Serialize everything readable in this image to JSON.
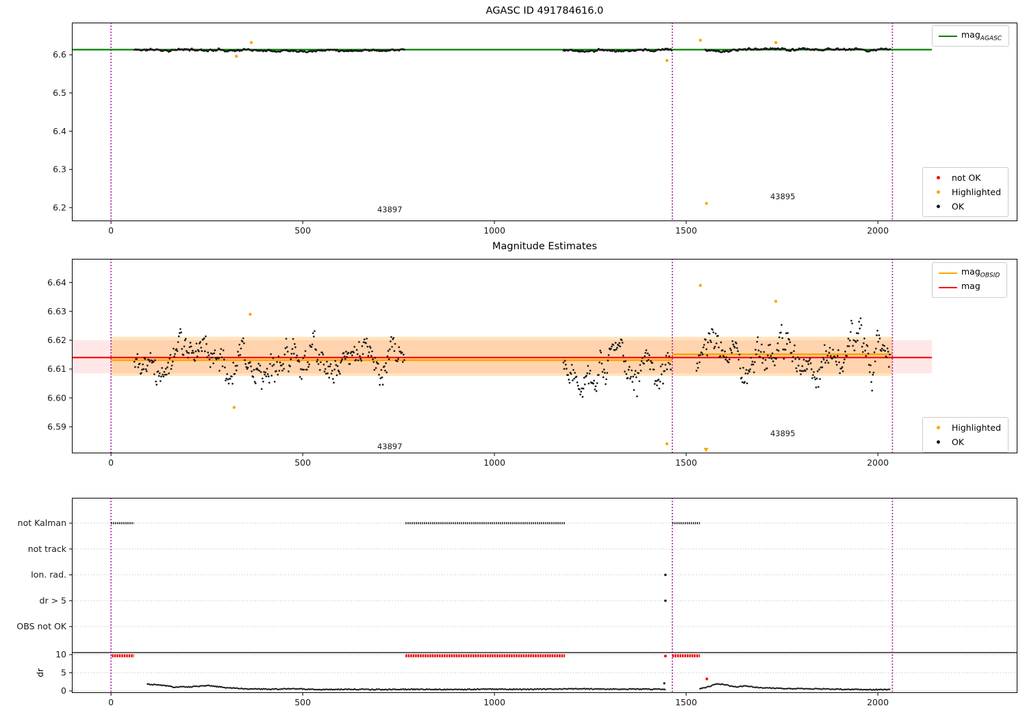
{
  "colors": {
    "agasc_line": "#008000",
    "obsid_line": "#ffa500",
    "mag_line": "#ff0000",
    "boundary_line": "#990099",
    "ok_marker": "#1a1a1a",
    "highlight_marker": "#ffa500",
    "notok_marker": "#ff0000",
    "cap_red": "#e81010",
    "grid": "#bbbbbb",
    "band_pink": "rgba(255,20,20,0.10)",
    "band_orange": "rgba(255,150,0,0.25)"
  },
  "chart_data": [
    {
      "id": "top",
      "type": "scatter",
      "title": "AGASC ID 491784616.0",
      "xlim": [
        -102,
        2364
      ],
      "ylim": [
        6.1645,
        6.6842
      ],
      "xticks": [
        0,
        500,
        1000,
        1500,
        2000
      ],
      "yticks": [
        6.2,
        6.3,
        6.4,
        6.5,
        6.6
      ],
      "ytick_labels": [
        "6.2",
        "6.3",
        "6.4",
        "6.5",
        "6.6"
      ],
      "grid": false,
      "legend_line": {
        "label_main": "mag",
        "label_sub": "AGASC"
      },
      "legend_markers": [
        {
          "label": "not OK",
          "color_key": "notok_marker"
        },
        {
          "label": "Highlighted",
          "color_key": "highlight_marker"
        },
        {
          "label": "OK",
          "color_key": "ok_marker"
        }
      ],
      "agasc_mag": {
        "value": 6.6134,
        "x0": -102,
        "x1": 2141
      },
      "obsid_boundaries": [
        0,
        1464,
        2038
      ],
      "scatter_segments": [
        {
          "x0": 61,
          "x1": 765,
          "mean": 6.6128,
          "amp": 0.0035,
          "seed": 11
        },
        {
          "x0": 1180,
          "x1": 1462,
          "mean": 6.6126,
          "amp": 0.0035,
          "seed": 12
        },
        {
          "x0": 1550,
          "x1": 2032,
          "mean": 6.6138,
          "amp": 0.0035,
          "seed": 13
        }
      ],
      "highlighted_points": [
        [
          327,
          6.596
        ],
        [
          366,
          6.632
        ],
        [
          1450,
          6.585
        ],
        [
          1537,
          6.638
        ],
        [
          1553,
          6.211
        ],
        [
          1734,
          6.632
        ]
      ],
      "annotations": [
        {
          "text": "43897",
          "x": 727,
          "y": 6.195
        },
        {
          "text": "43895",
          "x": 1752,
          "y": 6.229
        }
      ]
    },
    {
      "id": "middle",
      "type": "scatter",
      "title": "Magnitude Estimates",
      "xlim": [
        -102,
        2364
      ],
      "ylim": [
        6.5808,
        6.6482
      ],
      "xticks": [
        0,
        500,
        1000,
        1500,
        2000
      ],
      "yticks": [
        6.59,
        6.6,
        6.61,
        6.62,
        6.63,
        6.64
      ],
      "ytick_labels": [
        "6.59",
        "6.60",
        "6.61",
        "6.62",
        "6.63",
        "6.64"
      ],
      "grid": false,
      "legend_lines": [
        {
          "label_main": "mag",
          "label_sub": "OBSID",
          "color_key": "obsid_line"
        },
        {
          "label_main": "mag",
          "label_sub": "",
          "color_key": "mag_line"
        }
      ],
      "legend_markers": [
        {
          "label": "Highlighted",
          "color_key": "highlight_marker"
        },
        {
          "label": "OK",
          "color_key": "ok_marker"
        }
      ],
      "mag_line": {
        "value": 6.614,
        "x0": -102,
        "x1": 2141
      },
      "obsid_lines": [
        {
          "x0": 0,
          "x1": 1464,
          "value": 6.6131
        },
        {
          "x0": 1464,
          "x1": 2038,
          "value": 6.6151
        }
      ],
      "band_pink": {
        "x0": -102,
        "x1": 2141,
        "y0": 6.6085,
        "y1": 6.62
      },
      "band_orange": {
        "x0": 0,
        "x1": 2038,
        "y0": 6.6076,
        "y1": 6.6212
      },
      "obsid_boundaries": [
        0,
        1464,
        2038
      ],
      "scatter_segments": [
        {
          "x0": 61,
          "x1": 765,
          "mean": 6.6133,
          "amp": 0.0075,
          "seed": 21
        },
        {
          "x0": 1180,
          "x1": 1461,
          "mean": 6.6128,
          "amp": 0.0075,
          "seed": 22
        },
        {
          "x0": 1527,
          "x1": 2032,
          "mean": 6.6146,
          "amp": 0.0075,
          "seed": 23
        }
      ],
      "highlighted_points": [
        [
          321,
          6.5967
        ],
        [
          363,
          6.629
        ],
        [
          1450,
          6.5841
        ],
        [
          1537,
          6.639
        ],
        [
          1734,
          6.6335
        ]
      ],
      "clipped_low_points": [
        [
          1552,
          6.582
        ]
      ],
      "annotations": [
        {
          "text": "43897",
          "x": 727,
          "y": 6.5832
        },
        {
          "text": "43895",
          "x": 1752,
          "y": 6.5877
        }
      ]
    },
    {
      "id": "bottom",
      "type": "flags-and-dr",
      "categories": [
        "not Kalman",
        "not track",
        "Ion. rad.",
        "dr > 5",
        "OBS not OK"
      ],
      "ylabel": "dr",
      "dr_ticks": [
        0,
        5,
        10
      ],
      "dr_tick_labels": [
        "0",
        "5",
        "10"
      ],
      "xlim": [
        -102,
        2364
      ],
      "xticks": [
        0,
        500,
        1000,
        1500,
        2000
      ],
      "obsid_boundaries": [
        0,
        1464,
        2038
      ],
      "flag_segments": {
        "not Kalman": [
          [
            0,
            60
          ],
          [
            768,
            1184
          ],
          [
            1464,
            1536
          ]
        ]
      },
      "flag_points": {
        "Ion. rad.": [
          1446
        ],
        "dr > 5": [
          1446
        ]
      },
      "dr_cap_segments": [
        [
          2,
          60
        ],
        [
          768,
          1184
        ],
        [
          1464,
          1536
        ]
      ],
      "dr_cap_value": 9.7,
      "separator_dr": 10.57,
      "dr_trace": [
        {
          "seed": 31,
          "points": [
            [
              95,
              1.85
            ],
            [
              130,
              1.6
            ],
            [
              165,
              1.05
            ],
            [
              210,
              1.15
            ],
            [
              255,
              1.45
            ],
            [
              300,
              0.9
            ],
            [
              360,
              0.55
            ],
            [
              420,
              0.5
            ],
            [
              480,
              0.6
            ],
            [
              540,
              0.4
            ],
            [
              620,
              0.45
            ],
            [
              700,
              0.4
            ],
            [
              800,
              0.45
            ],
            [
              900,
              0.4
            ],
            [
              1000,
              0.5
            ],
            [
              1100,
              0.45
            ],
            [
              1200,
              0.6
            ],
            [
              1300,
              0.5
            ],
            [
              1380,
              0.5
            ],
            [
              1446,
              0.45
            ]
          ]
        },
        {
          "seed": 32,
          "points": [
            [
              1536,
              0.6
            ],
            [
              1560,
              1.2
            ],
            [
              1577,
              1.95
            ],
            [
              1600,
              1.75
            ],
            [
              1625,
              1.1
            ],
            [
              1655,
              1.35
            ],
            [
              1690,
              0.9
            ],
            [
              1750,
              0.7
            ],
            [
              1850,
              0.55
            ],
            [
              1950,
              0.4
            ],
            [
              2032,
              0.35
            ]
          ]
        }
      ],
      "extra_points": {
        "red": [
          [
            1446,
            9.6
          ],
          [
            1554,
            3.3
          ]
        ],
        "black": [
          [
            1443,
            2.1
          ]
        ]
      }
    }
  ]
}
